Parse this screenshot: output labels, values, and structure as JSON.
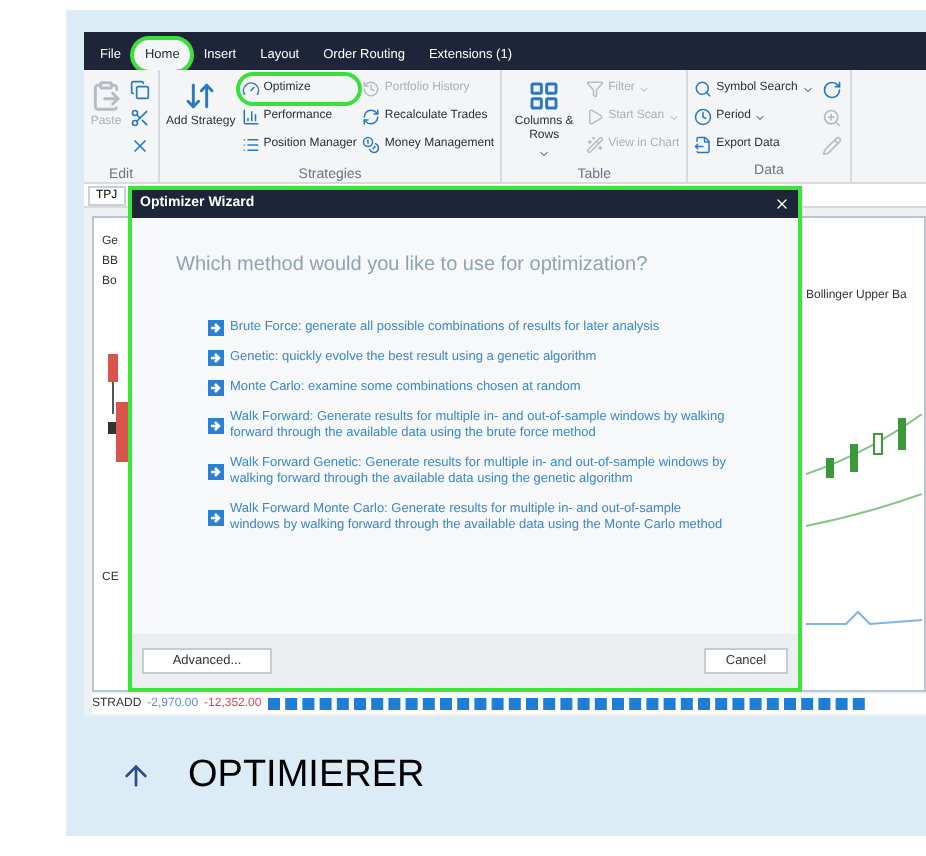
{
  "app": {
    "menu_tabs": [
      {
        "label": "File",
        "selected": false,
        "circled": false
      },
      {
        "label": "Home",
        "selected": true,
        "circled": true
      },
      {
        "label": "Insert",
        "selected": false,
        "circled": false
      },
      {
        "label": "Layout",
        "selected": false,
        "circled": false
      },
      {
        "label": "Order Routing",
        "selected": false,
        "circled": false
      },
      {
        "label": "Extensions (1)",
        "selected": false,
        "circled": false
      }
    ],
    "ribbon": {
      "groups": [
        {
          "label": "Edit",
          "items": [
            {
              "kind": "large",
              "label": "Paste",
              "disabled": true,
              "circled": false,
              "dropdown": false
            },
            {
              "kind": "icon",
              "disabled": false
            },
            {
              "kind": "icon",
              "disabled": false
            },
            {
              "kind": "icon",
              "disabled": false
            }
          ]
        },
        {
          "label": "Strategies",
          "items": [
            {
              "kind": "large",
              "label": "Add Strategy",
              "disabled": false,
              "circled": false,
              "dropdown": false
            },
            {
              "kind": "small",
              "label": "Optimize",
              "disabled": false,
              "circled": true,
              "dropdown": false
            },
            {
              "kind": "small",
              "label": "Performance",
              "disabled": false,
              "circled": false,
              "dropdown": false
            },
            {
              "kind": "small",
              "label": "Position Manager",
              "disabled": false,
              "circled": false,
              "dropdown": false
            },
            {
              "kind": "small",
              "label": "Portfolio History",
              "disabled": true,
              "circled": false,
              "dropdown": false
            },
            {
              "kind": "small",
              "label": "Recalculate Trades",
              "disabled": false,
              "circled": false,
              "dropdown": false
            },
            {
              "kind": "small",
              "label": "Money Management",
              "disabled": false,
              "circled": false,
              "dropdown": false
            }
          ]
        },
        {
          "label": "Table",
          "items": [
            {
              "kind": "large",
              "label": "Columns & Rows",
              "disabled": false,
              "circled": false,
              "dropdown": true
            },
            {
              "kind": "small",
              "label": "Filter",
              "disabled": true,
              "circled": false,
              "dropdown": true
            },
            {
              "kind": "small",
              "label": "Start Scan",
              "disabled": true,
              "circled": false,
              "dropdown": true
            },
            {
              "kind": "small",
              "label": "View in Chart",
              "disabled": true,
              "circled": false,
              "dropdown": false
            }
          ]
        },
        {
          "label": "Data",
          "items": [
            {
              "kind": "small",
              "label": "Symbol Search",
              "disabled": false,
              "circled": false,
              "dropdown": true
            },
            {
              "kind": "small",
              "label": "Period",
              "disabled": false,
              "circled": false,
              "dropdown": true
            },
            {
              "kind": "small",
              "label": "Export Data",
              "disabled": false,
              "circled": false,
              "dropdown": false
            },
            {
              "kind": "icon",
              "disabled": false
            },
            {
              "kind": "icon",
              "disabled": true
            },
            {
              "kind": "icon",
              "disabled": true
            }
          ]
        }
      ]
    },
    "chart": {
      "tab": "TPJ",
      "legend": [
        "Ge",
        "BB",
        "Bo"
      ],
      "right_label": "Bollinger Upper Ba",
      "lower_legend": "CE",
      "bottom": {
        "name": "STRADD",
        "value_1": "-2,970.00",
        "value_2": "-12,352.00"
      }
    },
    "dialog": {
      "title": "Optimizer Wizard",
      "question": "Which method would you like to use for optimization?",
      "options": [
        "Brute Force: generate all possible combinations of results for later analysis",
        "Genetic: quickly evolve the best result using a genetic algorithm",
        "Monte Carlo: examine some combinations chosen at random",
        "Walk Forward: Generate results for multiple in- and out-of-sample windows by walking forward through the available data using the brute force method",
        "Walk Forward Genetic: Generate results for multiple in- and out-of-sample windows by walking forward through the available data using the genetic algorithm",
        "Walk Forward Monte Carlo: Generate results for multiple in- and out-of-sample windows by walking forward through the available data using the Monte Carlo method"
      ],
      "buttons": [
        "Advanced...",
        "Cancel"
      ]
    }
  },
  "caption": {
    "text": "OPTIMIERER"
  }
}
